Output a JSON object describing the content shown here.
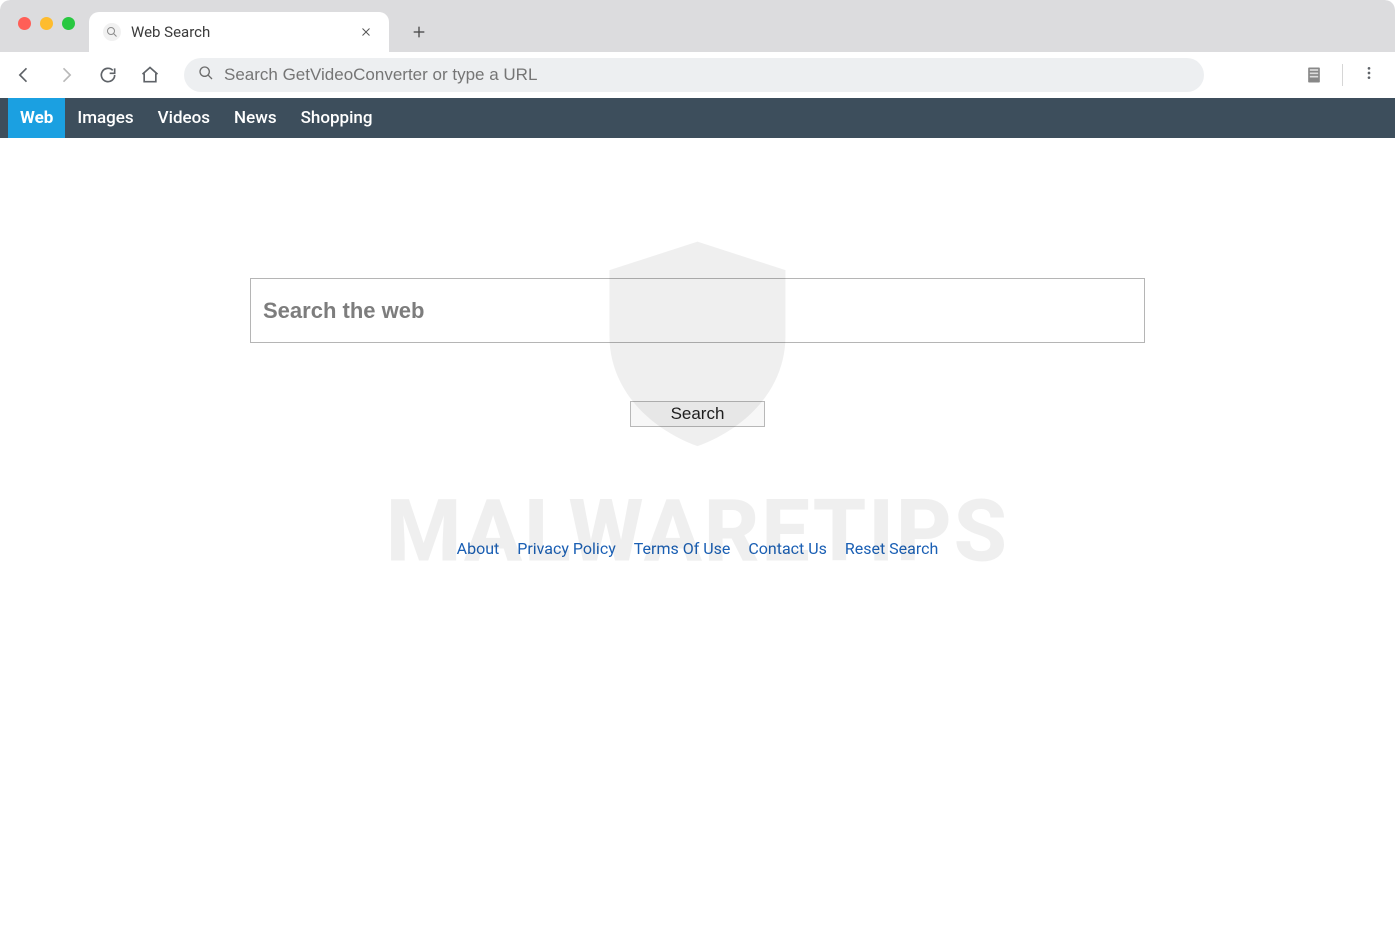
{
  "browser": {
    "tab_title": "Web Search",
    "omnibox_placeholder": "Search GetVideoConverter or type a URL"
  },
  "nav": {
    "items": [
      {
        "label": "Web",
        "active": true
      },
      {
        "label": "Images",
        "active": false
      },
      {
        "label": "Videos",
        "active": false
      },
      {
        "label": "News",
        "active": false
      },
      {
        "label": "Shopping",
        "active": false
      }
    ]
  },
  "search": {
    "placeholder": "Search the web",
    "button_label": "Search"
  },
  "footer": {
    "links": [
      "About",
      "Privacy Policy",
      "Terms Of Use",
      "Contact Us",
      "Reset Search"
    ]
  },
  "watermark": {
    "text": "MALWARETIPS"
  }
}
